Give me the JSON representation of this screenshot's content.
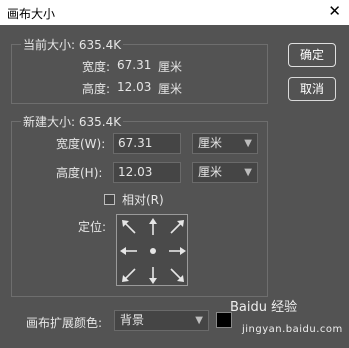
{
  "window": {
    "title": "画布大小",
    "close_glyph": "✕"
  },
  "current_size": {
    "heading": "当前大小: 635.4K",
    "width_label": "宽度:",
    "width_value": "67.31",
    "width_unit": "厘米",
    "height_label": "高度:",
    "height_value": "12.03",
    "height_unit": "厘米"
  },
  "new_size": {
    "heading": "新建大小: 635.4K",
    "width_label": "宽度(W):",
    "width_value": "67.31",
    "width_unit": "厘米",
    "height_label": "高度(H):",
    "height_value": "12.03",
    "height_unit": "厘米",
    "relative_label": "相对(R)",
    "relative_checked": false,
    "anchor_label": "定位:",
    "anchor_selected": "center"
  },
  "buttons": {
    "ok": "确定",
    "cancel": "取消"
  },
  "extension": {
    "label": "画布扩展颜色:",
    "value": "背景",
    "color": "#000000"
  },
  "watermark": {
    "text": "Baidu 经验",
    "sub": "jingyan.baidu.com"
  },
  "colors": {
    "panel": "#535353",
    "field": "#454545",
    "text": "#e6e6e6"
  }
}
